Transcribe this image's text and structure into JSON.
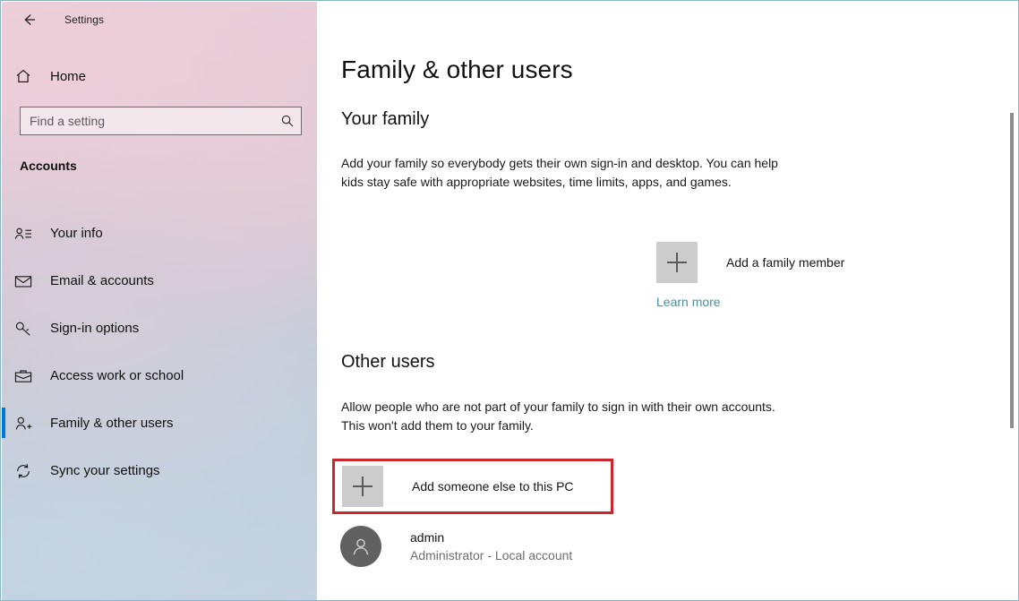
{
  "window": {
    "title": "Settings",
    "back_icon": "back-arrow-icon",
    "controls": {
      "minimize": "─",
      "maximize": "☐",
      "close": "✕"
    }
  },
  "sidebar": {
    "home": {
      "label": "Home",
      "icon": "home-icon"
    },
    "search": {
      "placeholder": "Find a setting",
      "value": "",
      "icon": "search-icon"
    },
    "category": "Accounts",
    "items": [
      {
        "label": "Your info",
        "icon": "contact-card-icon",
        "selected": false
      },
      {
        "label": "Email & accounts",
        "icon": "envelope-icon",
        "selected": false
      },
      {
        "label": "Sign-in options",
        "icon": "key-icon",
        "selected": false
      },
      {
        "label": "Access work or school",
        "icon": "briefcase-icon",
        "selected": false
      },
      {
        "label": "Family & other users",
        "icon": "add-person-icon",
        "selected": true
      },
      {
        "label": "Sync your settings",
        "icon": "sync-icon",
        "selected": false
      }
    ],
    "accent_color": "#0078d7"
  },
  "main": {
    "page_title": "Family & other users",
    "your_family": {
      "heading": "Your family",
      "description": "Add your family so everybody gets their own sign-in and desktop. You can help kids stay safe with appropriate websites, time limits, apps, and games.",
      "add_button_label": "Add a family member",
      "add_button_icon": "plus-icon",
      "learn_more_label": "Learn more",
      "learn_more_color": "#4a8fa3"
    },
    "other_users": {
      "heading": "Other users",
      "description": "Allow people who are not part of your family to sign in with their own accounts. This won't add them to your family.",
      "add_button_label": "Add someone else to this PC",
      "add_button_icon": "plus-icon",
      "highlight_color": "#c9272d",
      "accounts": [
        {
          "name": "admin",
          "detail": "Administrator - Local account",
          "avatar_icon": "person-avatar-icon"
        }
      ]
    }
  }
}
